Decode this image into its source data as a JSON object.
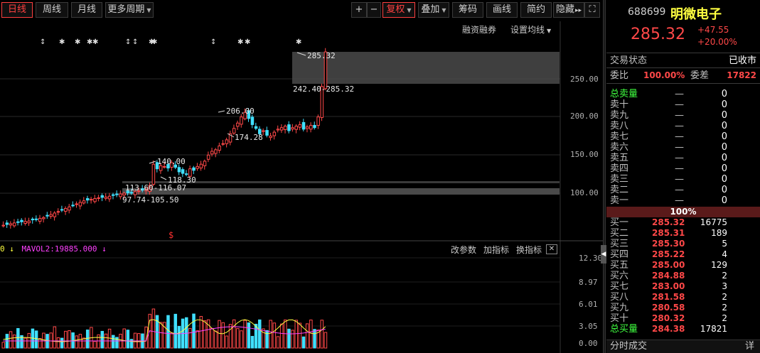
{
  "toolbar": {
    "periods": [
      "日线",
      "周线",
      "月线",
      "更多周期"
    ],
    "plus": "+",
    "minus": "−",
    "fq": "复权",
    "overlay": "叠加",
    "chips": "筹码",
    "draw": "画线",
    "simple": "简约",
    "hide": "隐藏",
    "arrows": "▸▸",
    "fullscreen": "⛶"
  },
  "subbar": {
    "margin": "融资融券",
    "ma_settings": "设置均线"
  },
  "colors": {
    "up": "#ff4848",
    "down": "#40e0ff",
    "bg": "#000000",
    "accent": "#ffff40"
  },
  "price_axis": [
    "250.00",
    "200.00",
    "150.00",
    "100.00"
  ],
  "annotations": {
    "high": "285.32",
    "band_top": "242.40-285.32",
    "peak": "206.00",
    "trough": "174.28",
    "mid_high": "140.00",
    "mid_low": "118.30",
    "band_mid": "113.60-116.07",
    "band_low": "97.74-105.50",
    "s_marker": "$"
  },
  "vol": {
    "header_prefix": "0 ↓",
    "mavol2": "MAVOL2:19885.000 ↓",
    "tools": [
      "改参数",
      "加指标",
      "换指标"
    ],
    "close": "✕",
    "axis": [
      "12.30",
      "8.97",
      "6.01",
      "3.05",
      "0.00"
    ]
  },
  "quote": {
    "code": "688699",
    "name": "明微电子",
    "price": "285.32",
    "change": "+47.55",
    "change_pct": "+20.00%",
    "status_label": "交易状态",
    "status_value": "已收市",
    "ratio_label": "委比",
    "ratio_value": "100.00%",
    "diff_label": "委差",
    "diff_value": "17822",
    "sell_total_label": "总卖量",
    "sell_total_price": "—",
    "sell_total_vol": "0",
    "sells": [
      {
        "label": "卖十",
        "price": "—",
        "vol": "0"
      },
      {
        "label": "卖九",
        "price": "—",
        "vol": "0"
      },
      {
        "label": "卖八",
        "price": "—",
        "vol": "0"
      },
      {
        "label": "卖七",
        "price": "—",
        "vol": "0"
      },
      {
        "label": "卖六",
        "price": "—",
        "vol": "0"
      },
      {
        "label": "卖五",
        "price": "—",
        "vol": "0"
      },
      {
        "label": "卖四",
        "price": "—",
        "vol": "0"
      },
      {
        "label": "卖三",
        "price": "—",
        "vol": "0"
      },
      {
        "label": "卖二",
        "price": "—",
        "vol": "0"
      },
      {
        "label": "卖一",
        "price": "—",
        "vol": "0"
      }
    ],
    "mid_pct": "100%",
    "buys": [
      {
        "label": "买一",
        "price": "285.32",
        "vol": "16775"
      },
      {
        "label": "买二",
        "price": "285.31",
        "vol": "189"
      },
      {
        "label": "买三",
        "price": "285.30",
        "vol": "5"
      },
      {
        "label": "买四",
        "price": "285.22",
        "vol": "4"
      },
      {
        "label": "买五",
        "price": "285.00",
        "vol": "129"
      },
      {
        "label": "买六",
        "price": "284.88",
        "vol": "2"
      },
      {
        "label": "买七",
        "price": "283.00",
        "vol": "3"
      },
      {
        "label": "买八",
        "price": "281.58",
        "price2": "",
        "vol": "2"
      },
      {
        "label": "买九",
        "price": "280.58",
        "vol": "2"
      },
      {
        "label": "买十",
        "price": "280.32",
        "vol": "2"
      }
    ],
    "buy_total_label": "总买量",
    "buy_total_price": "284.38",
    "buy_total_vol": "17821",
    "bottom_tab": "分时成交",
    "detail": "详"
  }
}
